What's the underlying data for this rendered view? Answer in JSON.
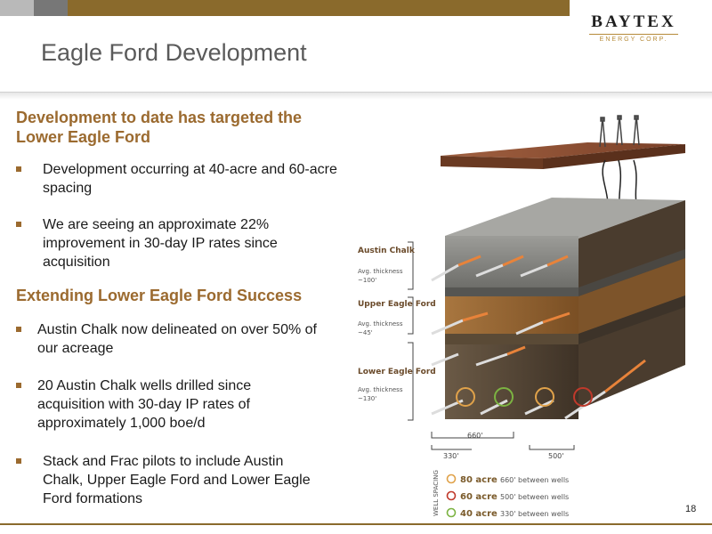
{
  "header": {
    "title": "Eagle Ford Development",
    "logo_name": "BAYTEX",
    "logo_sub": "ENERGY CORP."
  },
  "section1": {
    "heading": "Development to date has targeted the Lower Eagle Ford",
    "bullets": [
      "Development occurring at 40-acre and 60-acre spacing",
      "We are seeing an approximate 22% improvement in 30-day IP rates since acquisition"
    ]
  },
  "section2": {
    "heading": "Extending Lower Eagle Ford Success",
    "bullets": [
      "Austin Chalk now delineated on over 50% of our acreage",
      "20 Austin Chalk wells drilled since acquisition with 30-day IP rates of approximately 1,000 boe/d",
      "Stack and Frac pilots to include Austin Chalk, Upper Eagle Ford and Lower Eagle Ford formations"
    ]
  },
  "diagram": {
    "layers": [
      {
        "name": "Austin Chalk",
        "thickness_label": "Avg. thickness",
        "thickness": "~100'"
      },
      {
        "name": "Upper Eagle Ford",
        "thickness_label": "Avg. thickness",
        "thickness": "~45'"
      },
      {
        "name": "Lower Eagle Ford",
        "thickness_label": "Avg. thickness",
        "thickness": "~130'"
      }
    ],
    "dimensions": {
      "d660": "660'",
      "d330": "330'",
      "d500": "500'"
    },
    "spacing_title": "WELL SPACING",
    "spacing": [
      {
        "acre": "80 acre",
        "desc": "660' between wells",
        "color": "#e0a24a"
      },
      {
        "acre": "60 acre",
        "desc": "500' between wells",
        "color": "#c0392b"
      },
      {
        "acre": "40 acre",
        "desc": "330' between wells",
        "color": "#7cb342"
      }
    ]
  },
  "colors": {
    "accent": "#9b6a2f",
    "bar": "#8a6a2c"
  },
  "footer": {
    "page": "18"
  }
}
